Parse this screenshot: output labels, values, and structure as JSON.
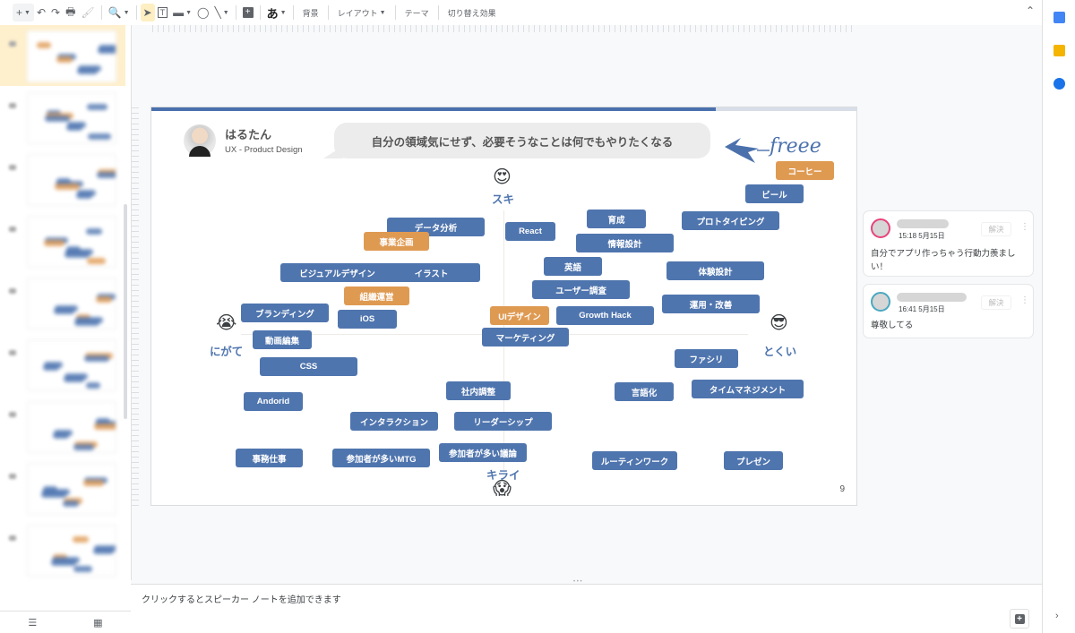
{
  "toolbar": {
    "new_label": "+",
    "undo": "↶",
    "redo": "↷",
    "print": "🖶",
    "paint_format": "🖌",
    "zoom": "🔍",
    "select": "➤",
    "textbox": "T",
    "image": "▬",
    "shape": "◯",
    "line": "╲",
    "comment": "+",
    "input_tool": "あ",
    "background_label": "背景",
    "layout_label": "レイアウト",
    "theme_label": "テーマ",
    "transition_label": "切り替え効果",
    "collapse": "⌃"
  },
  "slide": {
    "progress_percent": 80,
    "author_name": "はるたん",
    "author_role": "UX - Product Design",
    "speech_bubble": "自分の領域気にせず、必要そうなことは何でもやりたくなる",
    "logo_text": "freee",
    "slide_number": "9",
    "axis": {
      "top_label": "スキ",
      "top_emoji": "😍",
      "bottom_label": "キライ",
      "bottom_emoji": "😱",
      "left_label": "にがて",
      "left_emoji": "😭",
      "right_label": "とくい",
      "right_emoji": "😎"
    },
    "chips": [
      {
        "label": "コーヒー",
        "color": "orange"
      },
      {
        "label": "ビール",
        "color": "blue"
      },
      {
        "label": "育成",
        "color": "blue"
      },
      {
        "label": "プロトタイピング",
        "color": "blue"
      },
      {
        "label": "データ分析",
        "color": "blue"
      },
      {
        "label": "React",
        "color": "blue"
      },
      {
        "label": "情報設計",
        "color": "blue"
      },
      {
        "label": "事業企画",
        "color": "orange"
      },
      {
        "label": "ビジュアルデザイン",
        "color": "blue"
      },
      {
        "label": "イラスト",
        "color": "blue"
      },
      {
        "label": "英語",
        "color": "blue"
      },
      {
        "label": "体験設計",
        "color": "blue"
      },
      {
        "label": "組織運営",
        "color": "orange"
      },
      {
        "label": "ユーザー調査",
        "color": "blue"
      },
      {
        "label": "運用・改善",
        "color": "blue"
      },
      {
        "label": "ブランディング",
        "color": "blue"
      },
      {
        "label": "iOS",
        "color": "blue"
      },
      {
        "label": "UIデザイン",
        "color": "orange"
      },
      {
        "label": "Growth Hack",
        "color": "blue"
      },
      {
        "label": "動画編集",
        "color": "blue"
      },
      {
        "label": "マーケティング",
        "color": "blue"
      },
      {
        "label": "CSS",
        "color": "blue"
      },
      {
        "label": "ファシリ",
        "color": "blue"
      },
      {
        "label": "社内調整",
        "color": "blue"
      },
      {
        "label": "言語化",
        "color": "blue"
      },
      {
        "label": "タイムマネジメント",
        "color": "blue"
      },
      {
        "label": "Andorid",
        "color": "blue"
      },
      {
        "label": "インタラクション",
        "color": "blue"
      },
      {
        "label": "リーダーシップ",
        "color": "blue"
      },
      {
        "label": "参加者が多い議論",
        "color": "blue"
      },
      {
        "label": "事務仕事",
        "color": "blue"
      },
      {
        "label": "参加者が多いMTG",
        "color": "blue"
      },
      {
        "label": "ルーティンワーク",
        "color": "blue"
      },
      {
        "label": "プレゼン",
        "color": "blue"
      }
    ]
  },
  "notes": {
    "placeholder": "クリックするとスピーカー ノートを追加できます"
  },
  "comments": [
    {
      "time": "15:18 5月15日",
      "text": "自分でアプリ作っちゃう行動力羨ましい！",
      "resolve_label": "解決",
      "ring_color": "#e8437a"
    },
    {
      "time": "16:41 5月15日",
      "text": "尊敬してる",
      "resolve_label": "解決",
      "ring_color": "#4aa8c0"
    }
  ],
  "filmstrip": {
    "footer_list_icon": "☰",
    "footer_grid_icon": "▦"
  },
  "side_panel": {
    "calendar_color": "#4285f4",
    "keep_color": "#f4b400",
    "tasks_color": "#1a73e8",
    "expand_icon": "›"
  },
  "colors": {
    "chip_blue": "#4f75ae",
    "chip_orange": "#df9a52",
    "accent": "#4b71ad"
  }
}
